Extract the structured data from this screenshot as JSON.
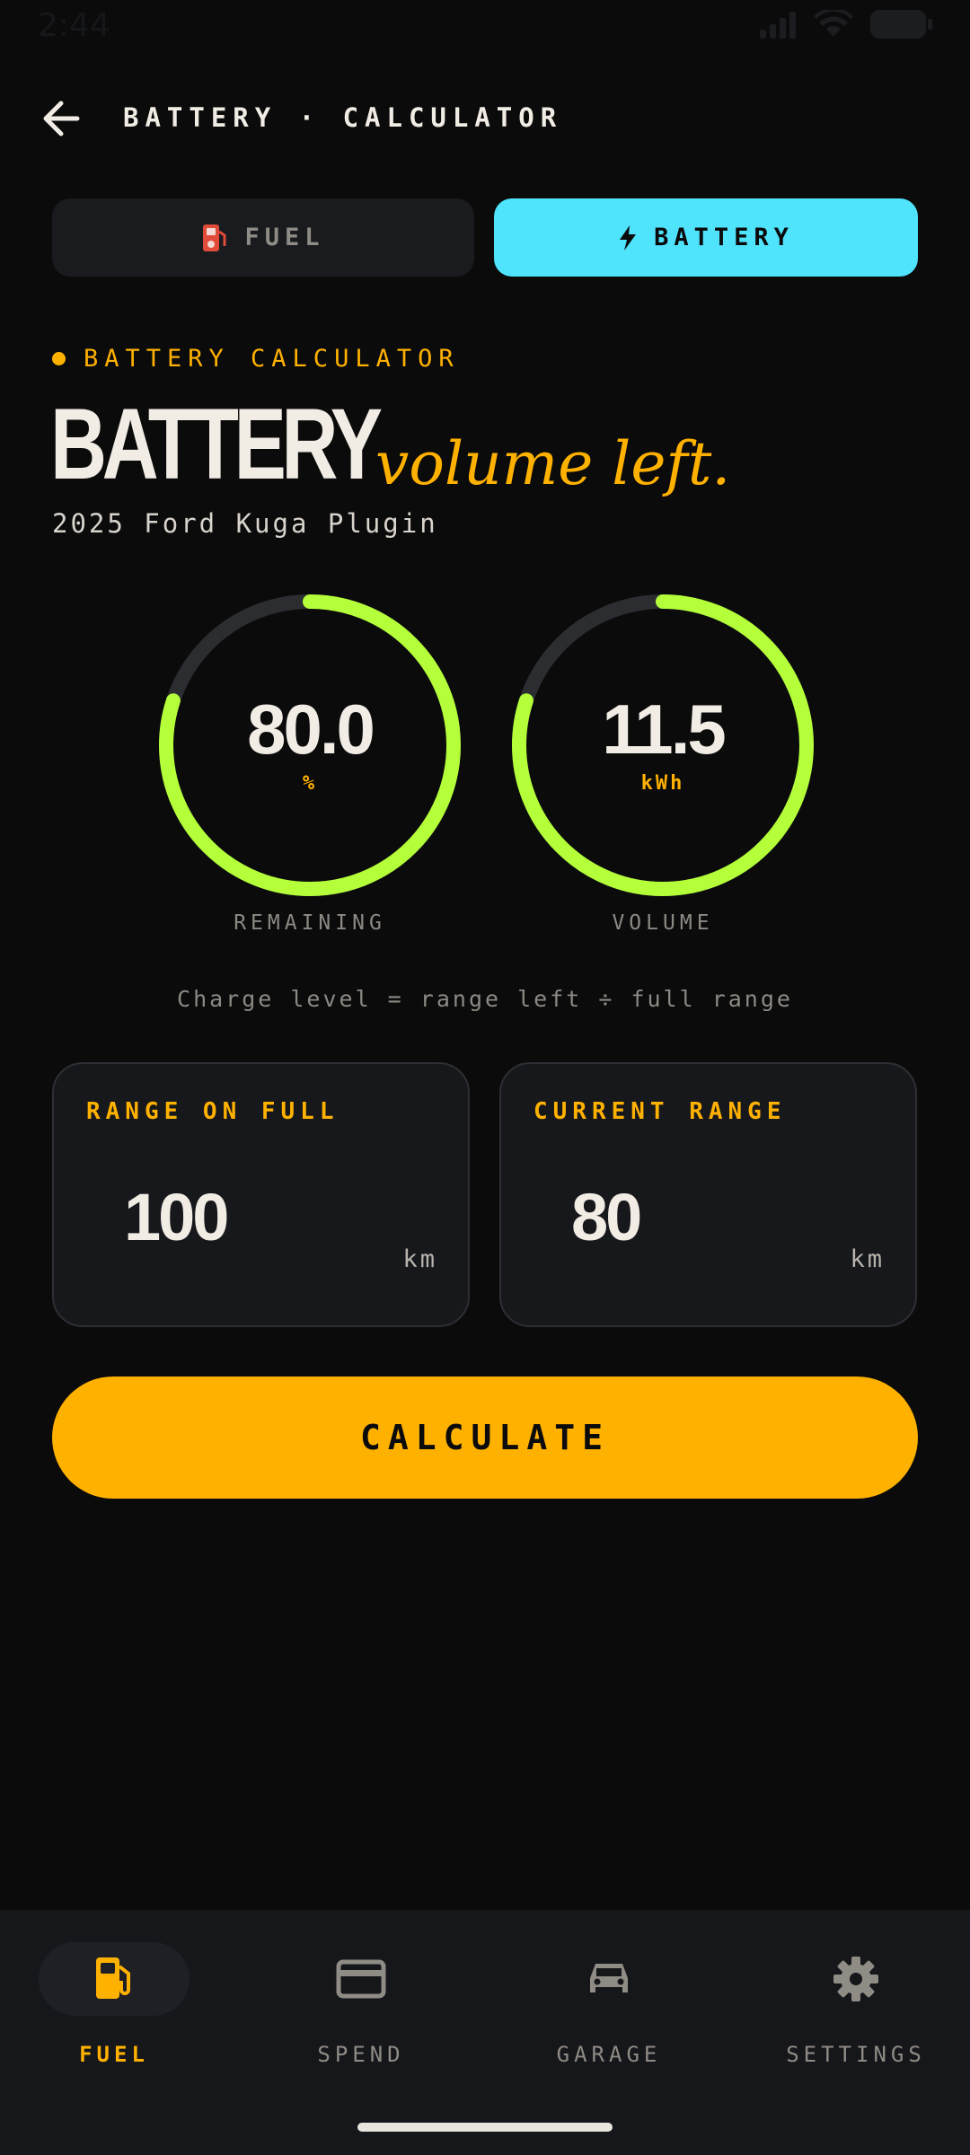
{
  "status_bar": {
    "time": "2:44"
  },
  "header": {
    "title": "BATTERY · CALCULATOR"
  },
  "mode_toggle": {
    "fuel_label": "FUEL",
    "battery_label": "BATTERY",
    "selected": "BATTERY"
  },
  "section": {
    "eyebrow": "BATTERY CALCULATOR",
    "title_main": "BATTERY",
    "title_script": "volume left.",
    "vehicle": "2025 Ford Kuga Plugin"
  },
  "gauges": [
    {
      "value": "80.0",
      "unit": "%",
      "label": "REMAINING",
      "fill_fraction": 0.8
    },
    {
      "value": "11.5",
      "unit": "kWh",
      "label": "VOLUME",
      "fill_fraction": 0.8
    }
  ],
  "formula": "Charge level = range left ÷ full range",
  "inputs": {
    "range_on_full": {
      "label": "RANGE ON FULL",
      "value": "100",
      "unit": "km"
    },
    "current_range": {
      "label": "CURRENT RANGE",
      "value": "80",
      "unit": "km"
    }
  },
  "calculate_label": "CALCULATE",
  "bottom_nav": [
    {
      "label": "FUEL",
      "icon": "fuel-pump-icon",
      "active": true
    },
    {
      "label": "SPEND",
      "icon": "credit-card-icon",
      "active": false
    },
    {
      "label": "GARAGE",
      "icon": "car-icon",
      "active": false
    },
    {
      "label": "SETTINGS",
      "icon": "gear-icon",
      "active": false
    }
  ],
  "colors": {
    "background": "#0b0b0c",
    "accent_amber": "#ffb100",
    "accent_cyan": "#4fe3fc",
    "gauge_fill": "#b4ff3a",
    "gauge_track": "#2c2d31"
  }
}
